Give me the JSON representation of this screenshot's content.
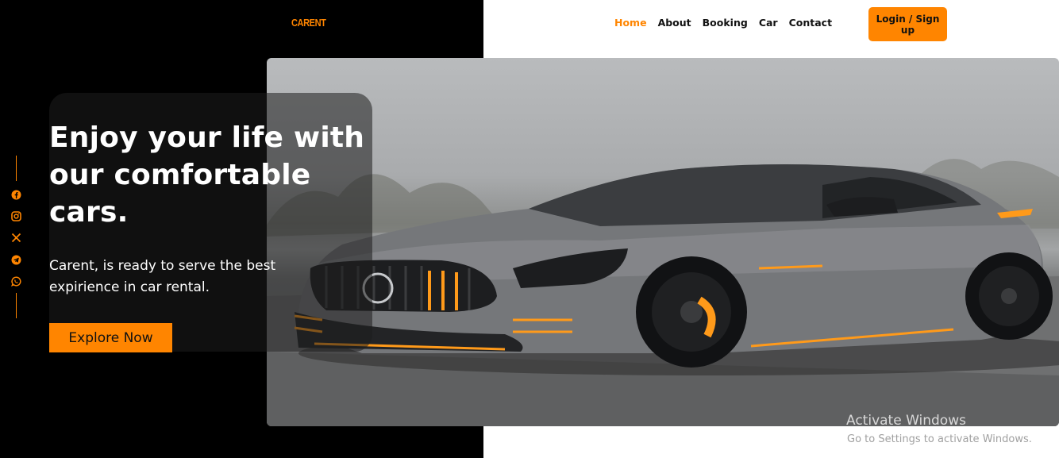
{
  "brand": {
    "name": "CARENT"
  },
  "nav": {
    "items": [
      {
        "label": "Home",
        "active": true
      },
      {
        "label": "About",
        "active": false
      },
      {
        "label": "Booking",
        "active": false
      },
      {
        "label": "Car",
        "active": false
      },
      {
        "label": "Contact",
        "active": false
      }
    ],
    "login_label": "Login / Sign up"
  },
  "hero": {
    "headline": "Enjoy your life with our comfortable cars.",
    "subtext": "Carent, is ready to serve the best expirience in car rental.",
    "cta_label": "Explore Now",
    "image_subject": "grey sports car"
  },
  "social": {
    "icons": [
      "facebook-icon",
      "instagram-icon",
      "x-icon",
      "telegram-icon",
      "whatsapp-icon"
    ]
  },
  "watermark": {
    "title": "Activate Windows",
    "subtitle": "Go to Settings to activate Windows."
  },
  "colors": {
    "accent": "#ff8500",
    "left_panel": "#000000",
    "background": "#ffffff"
  }
}
